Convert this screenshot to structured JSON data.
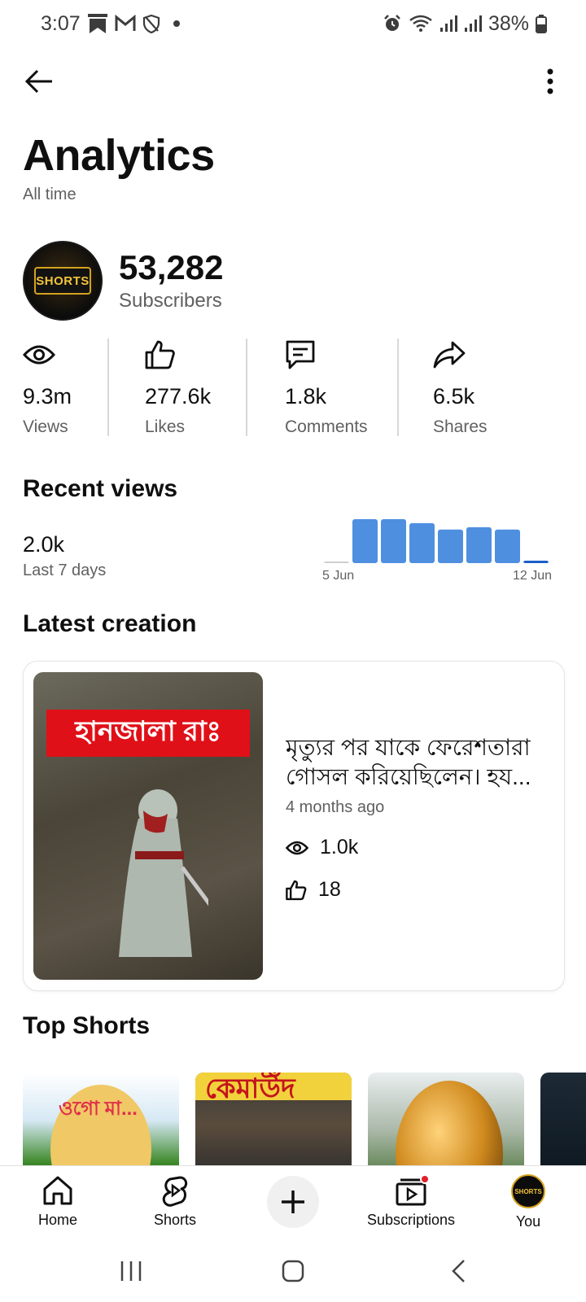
{
  "status_bar": {
    "time": "3:07",
    "battery": "38%"
  },
  "header": {
    "title": "Analytics",
    "subtitle": "All time"
  },
  "channel": {
    "subscriber_count": "53,282",
    "subscriber_label": "Subscribers",
    "avatar_text": "SHORTS"
  },
  "metrics": [
    {
      "value": "9.3m",
      "label": "Views",
      "icon": "eye-icon"
    },
    {
      "value": "277.6k",
      "label": "Likes",
      "icon": "thumbs-up-icon"
    },
    {
      "value": "1.8k",
      "label": "Comments",
      "icon": "comment-icon"
    },
    {
      "value": "6.5k",
      "label": "Shares",
      "icon": "share-icon"
    }
  ],
  "recent_views": {
    "title": "Recent views",
    "value": "2.0k",
    "period": "Last 7 days",
    "chart_data": {
      "type": "bar",
      "categories": [
        "5 Jun",
        "6 Jun",
        "7 Jun",
        "8 Jun",
        "9 Jun",
        "10 Jun",
        "11 Jun",
        "12 Jun"
      ],
      "values": [
        2,
        55,
        55,
        50,
        42,
        45,
        42,
        3
      ],
      "xtick_labels": [
        "5 Jun",
        "12 Jun"
      ],
      "colors": {
        "bar": "#4f8fe0",
        "current": "#1a5fc8",
        "empty": "#cfcfcf"
      }
    }
  },
  "latest_creation": {
    "title": "Latest creation",
    "video_title": "মৃত্যুর পর যাকে ফেরেশতারা গোসল করিয়েছিলেন। হয...",
    "thumbnail_text": "হানজালা রাঃ",
    "age": "4 months ago",
    "views": "1.0k",
    "likes": "18"
  },
  "top_shorts": {
    "title": "Top Shorts",
    "thumb_texts": [
      "ওগো মা...",
      "কেমাউঁদ"
    ]
  },
  "bottom_nav": [
    {
      "label": "Home",
      "icon": "home-icon"
    },
    {
      "label": "Shorts",
      "icon": "shorts-icon"
    },
    {
      "label": "",
      "icon": "plus-icon"
    },
    {
      "label": "Subscriptions",
      "icon": "subscriptions-icon"
    },
    {
      "label": "You",
      "icon": "avatar"
    }
  ],
  "colors": {
    "accent_red": "#e0202a",
    "bar_blue": "#4f8fe0"
  }
}
